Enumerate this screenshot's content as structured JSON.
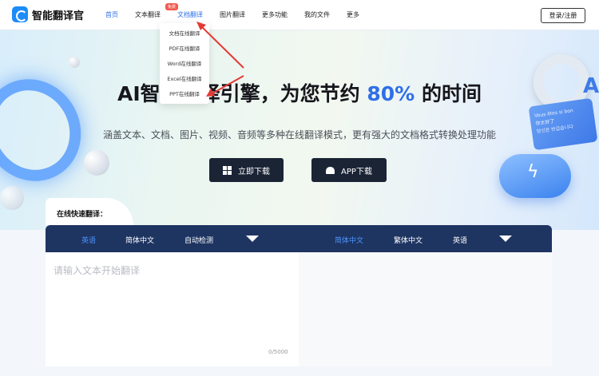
{
  "app": {
    "name": "智能翻译官"
  },
  "nav": {
    "items": [
      {
        "label": "首页"
      },
      {
        "label": "文本翻译",
        "badge": "免费"
      },
      {
        "label": "文档翻译"
      },
      {
        "label": "图片翻译"
      },
      {
        "label": "更多功能"
      },
      {
        "label": "我的文件"
      },
      {
        "label": "更多"
      }
    ],
    "login": "登录/注册"
  },
  "dropdown": {
    "items": [
      "文档在线翻译",
      "PDF在线翻译",
      "Word在线翻译",
      "Excel在线翻译",
      "PPT在线翻译"
    ]
  },
  "hero": {
    "title_prefix": "AI智能翻译引擎，为您节约 ",
    "title_highlight": "80%",
    "title_suffix": " 的时间",
    "subtitle": "涵盖文本、文档、图片、视频、音频等多种在线翻译模式，更有强大的文档格式转换处理功能",
    "download_button": "立即下载",
    "app_button": "APP下载",
    "card_text": "Vous êtes si bon\n你太好了\n당신은 반갑습니다"
  },
  "quick_translate": {
    "label": "在线快速翻译：",
    "source_langs": [
      "英语",
      "简体中文",
      "自动检测"
    ],
    "target_langs": [
      "简体中文",
      "繁体中文",
      "英语"
    ],
    "placeholder": "请输入文本开始翻译",
    "counter": "0/5000"
  },
  "colors": {
    "accent": "#2f6fe8",
    "lang_bar": "#1e3461",
    "annotation_arrow": "#e53935"
  }
}
